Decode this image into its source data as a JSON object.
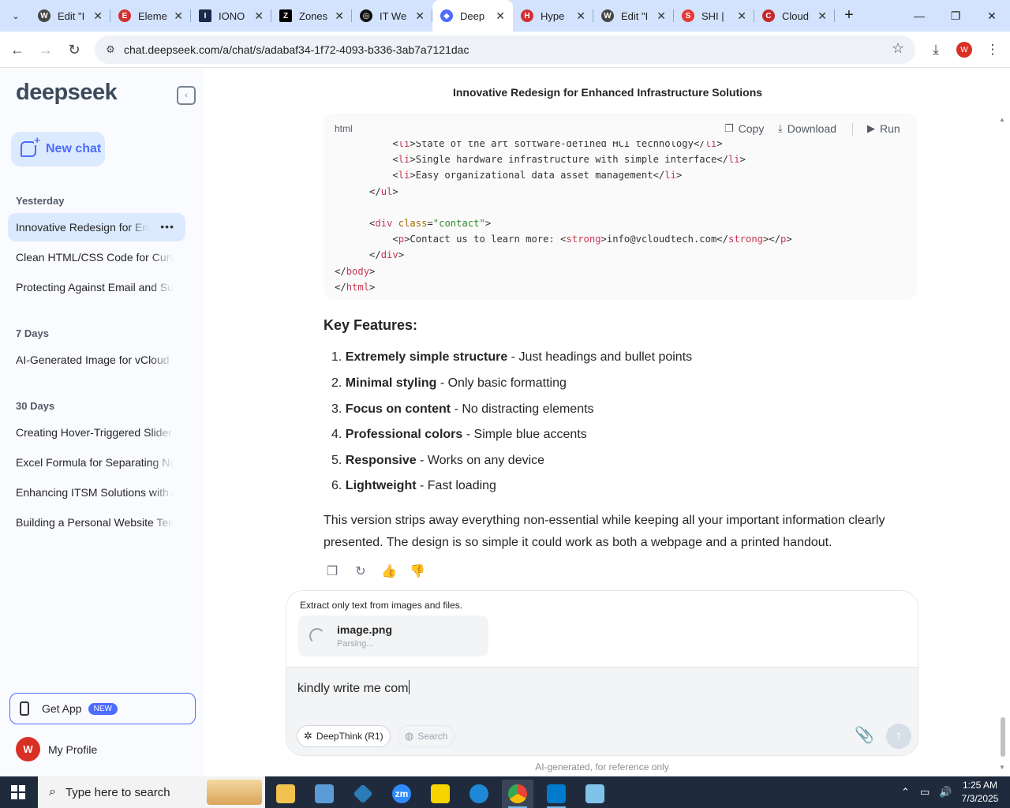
{
  "browser": {
    "tabs": [
      {
        "label": "Edit \"I",
        "icon": "wordpress-icon",
        "color": "#464646"
      },
      {
        "label": "Eleme",
        "icon": "elementor-icon",
        "color": "#d32f2f"
      },
      {
        "label": "IONO",
        "icon": "ionos-icon",
        "color": "#1b2a4a"
      },
      {
        "label": "Zones",
        "icon": "zones-icon",
        "color": "#000000"
      },
      {
        "label": "IT We",
        "icon": "openai-icon",
        "color": "#111111"
      },
      {
        "label": "Deep",
        "icon": "deepseek-icon",
        "color": "#4d6bfe",
        "active": true
      },
      {
        "label": "Hype",
        "icon": "hyper-icon",
        "color": "#d32f2f"
      },
      {
        "label": "Edit \"I",
        "icon": "wordpress-icon",
        "color": "#464646"
      },
      {
        "label": "SHI |",
        "icon": "shi-icon",
        "color": "#e53935"
      },
      {
        "label": "Cloud",
        "icon": "cloud-brand-icon",
        "color": "#c62828"
      }
    ],
    "url": "chat.deepseek.com/a/chat/s/adabaf34-1f72-4093-b336-3ab7a7121dac",
    "profile_initial": "W"
  },
  "sidebar": {
    "logo": "deepseek",
    "new_chat": "New chat",
    "sections": [
      {
        "label": "Yesterday",
        "items": [
          "Innovative Redesign for Enhanced Infrastructure Solutions",
          "Clean HTML/CSS Code for Curved Slider",
          "Protecting Against Email and Supply Chain Attacks"
        ]
      },
      {
        "label": "7 Days",
        "items": [
          "AI-Generated Image for vCloud Tech"
        ]
      },
      {
        "label": "30 Days",
        "items": [
          "Creating Hover-Triggered Slider Effects",
          "Excel Formula for Separating Names",
          "Enhancing ITSM Solutions with AI",
          "Building a Personal Website Template"
        ]
      }
    ],
    "get_app": "Get App",
    "new_badge": "NEW",
    "profile_initial": "W",
    "profile_label": "My Profile"
  },
  "main": {
    "title": "Innovative Redesign for Enhanced Infrastructure Solutions",
    "code": {
      "lang": "html",
      "copy": "Copy",
      "download": "Download",
      "run": "Run"
    },
    "key_features_title": "Key Features:",
    "features": [
      {
        "num": "1.",
        "bold": "Extremely simple structure",
        "rest": " - Just headings and bullet points"
      },
      {
        "num": "2.",
        "bold": "Minimal styling",
        "rest": " - Only basic formatting"
      },
      {
        "num": "3.",
        "bold": "Focus on content",
        "rest": " - No distracting elements"
      },
      {
        "num": "4.",
        "bold": "Professional colors",
        "rest": " - Simple blue accents"
      },
      {
        "num": "5.",
        "bold": "Responsive",
        "rest": " - Works on any device"
      },
      {
        "num": "6.",
        "bold": "Lightweight",
        "rest": " - Fast loading"
      }
    ],
    "summary": "This version strips away everything non-essential while keeping all your important information clearly presented. The design is so simple it could work as both a webpage and a printed handout."
  },
  "composer": {
    "extract_note": "Extract only text from images and files.",
    "file_name": "image.png",
    "file_status": "Parsing...",
    "input_value": "kindly write me com",
    "deepthink": "DeepThink (R1)",
    "search": "Search"
  },
  "disclaimer": "AI-generated, for reference only",
  "taskbar": {
    "search_placeholder": "Type here to search",
    "time": "1:25 AM",
    "date": "7/3/2025"
  }
}
